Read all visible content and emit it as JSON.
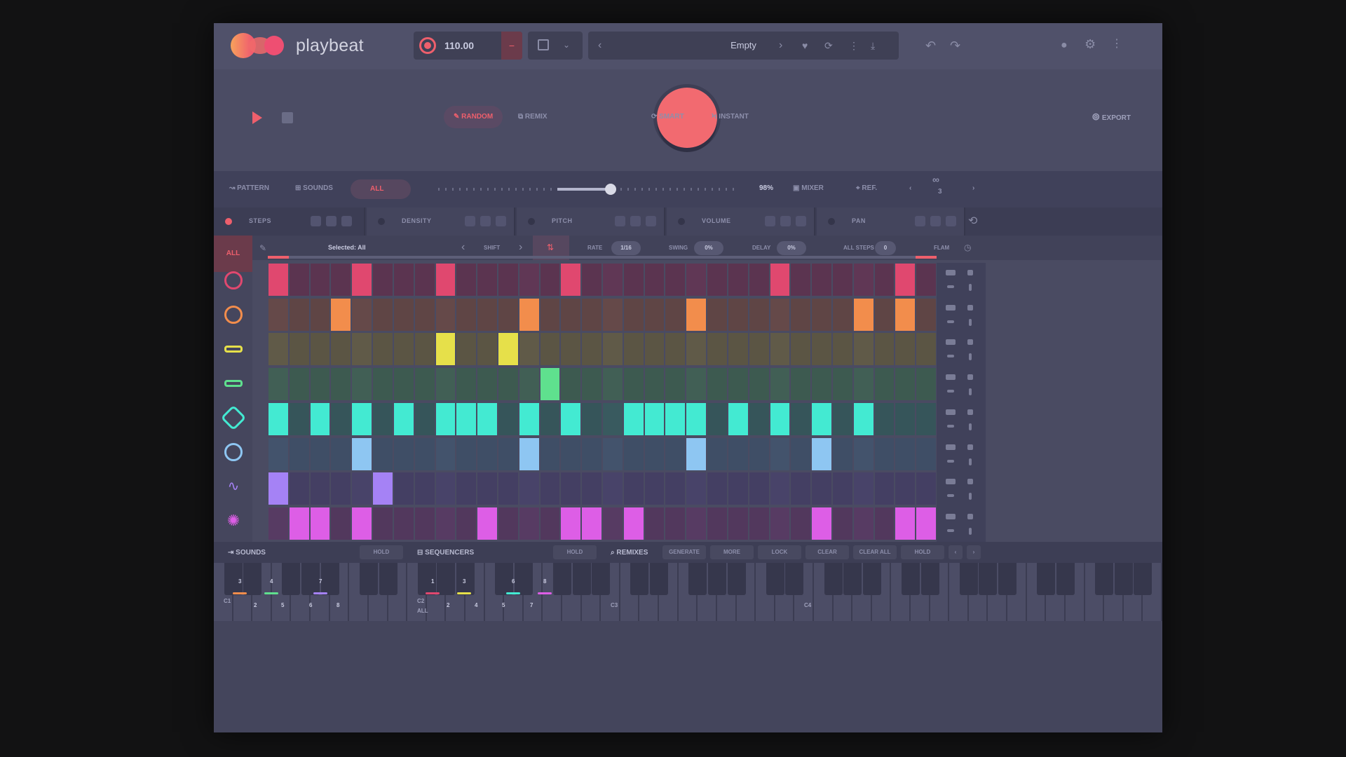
{
  "brand": "playbeat",
  "tempo": "110.00",
  "tempo_minus": "−",
  "preset": {
    "name": "Empty"
  },
  "transport": {
    "modes": [
      "RANDOM",
      "REMIX",
      "SMART",
      "INSTANT"
    ],
    "export": "EXPORT"
  },
  "pattern_bar": {
    "pattern": "PATTERN",
    "sounds": "SOUNDS",
    "all": "ALL",
    "percent": "98%",
    "mixer": "MIXER",
    "ref": "REF.",
    "link_count": "3"
  },
  "param_tabs": [
    "STEPS",
    "DENSITY",
    "PITCH",
    "VOLUME",
    "PAN"
  ],
  "subbar": {
    "selected": "Selected: All",
    "shift": "SHIFT",
    "rate_label": "RATE",
    "rate_value": "1/16",
    "swing_label": "SWING",
    "swing_value": "0%",
    "delay_label": "DELAY",
    "delay_value": "0%",
    "all_steps_label": "ALL STEPS",
    "all_steps_value": "0",
    "flam_label": "FLAM"
  },
  "sidebar_all": "ALL",
  "colors": {
    "accent": "#ee5f6c",
    "rows": [
      "#e0486f",
      "#f28d4c",
      "#e6e04a",
      "#5fe08e",
      "#43ead2",
      "#8ec6f2",
      "#a582f5",
      "#dd5ee6"
    ],
    "row_bg": [
      "#5b3450",
      "#5f4545",
      "#5b5544",
      "#3d5a50",
      "#36555a",
      "#3f4e66",
      "#443f63",
      "#52385d"
    ]
  },
  "sequencer": {
    "steps": 32,
    "rows": [
      {
        "name": "kick",
        "active": [
          0,
          4,
          8,
          14,
          24,
          30
        ]
      },
      {
        "name": "snare",
        "active": [
          3,
          12,
          20,
          28,
          30
        ]
      },
      {
        "name": "hihat-closed",
        "active": [
          8,
          11
        ]
      },
      {
        "name": "hihat-open",
        "active": [
          13
        ]
      },
      {
        "name": "percussion",
        "active": [
          0,
          2,
          4,
          6,
          8,
          9,
          10,
          12,
          14,
          17,
          18,
          19,
          20,
          22,
          24,
          26,
          28
        ]
      },
      {
        "name": "tom",
        "active": [
          4,
          12,
          20,
          26
        ]
      },
      {
        "name": "fx",
        "active": [
          0,
          5
        ]
      },
      {
        "name": "cymbal",
        "active": [
          1,
          2,
          4,
          10,
          14,
          15,
          17,
          26,
          30,
          31
        ]
      }
    ]
  },
  "bottombar": {
    "sounds": "SOUNDS",
    "hold1": "HOLD",
    "sequencers": "SEQUENCERS",
    "hold2": "HOLD",
    "remixes": "REMIXES",
    "buttons": [
      "GENERATE",
      "MORE",
      "LOCK",
      "CLEAR",
      "CLEAR ALL",
      "HOLD"
    ]
  },
  "keyboard": {
    "upper_nums": [
      "3",
      "4",
      "7",
      "1",
      "3",
      "6",
      "8"
    ],
    "lower_nums_1": [
      "2",
      "5",
      "6",
      "8"
    ],
    "lower_nums_2": [
      "2",
      "4",
      "5",
      "7"
    ],
    "notes": [
      "C1",
      "C2",
      "C3",
      "C4"
    ],
    "all": "ALL"
  }
}
